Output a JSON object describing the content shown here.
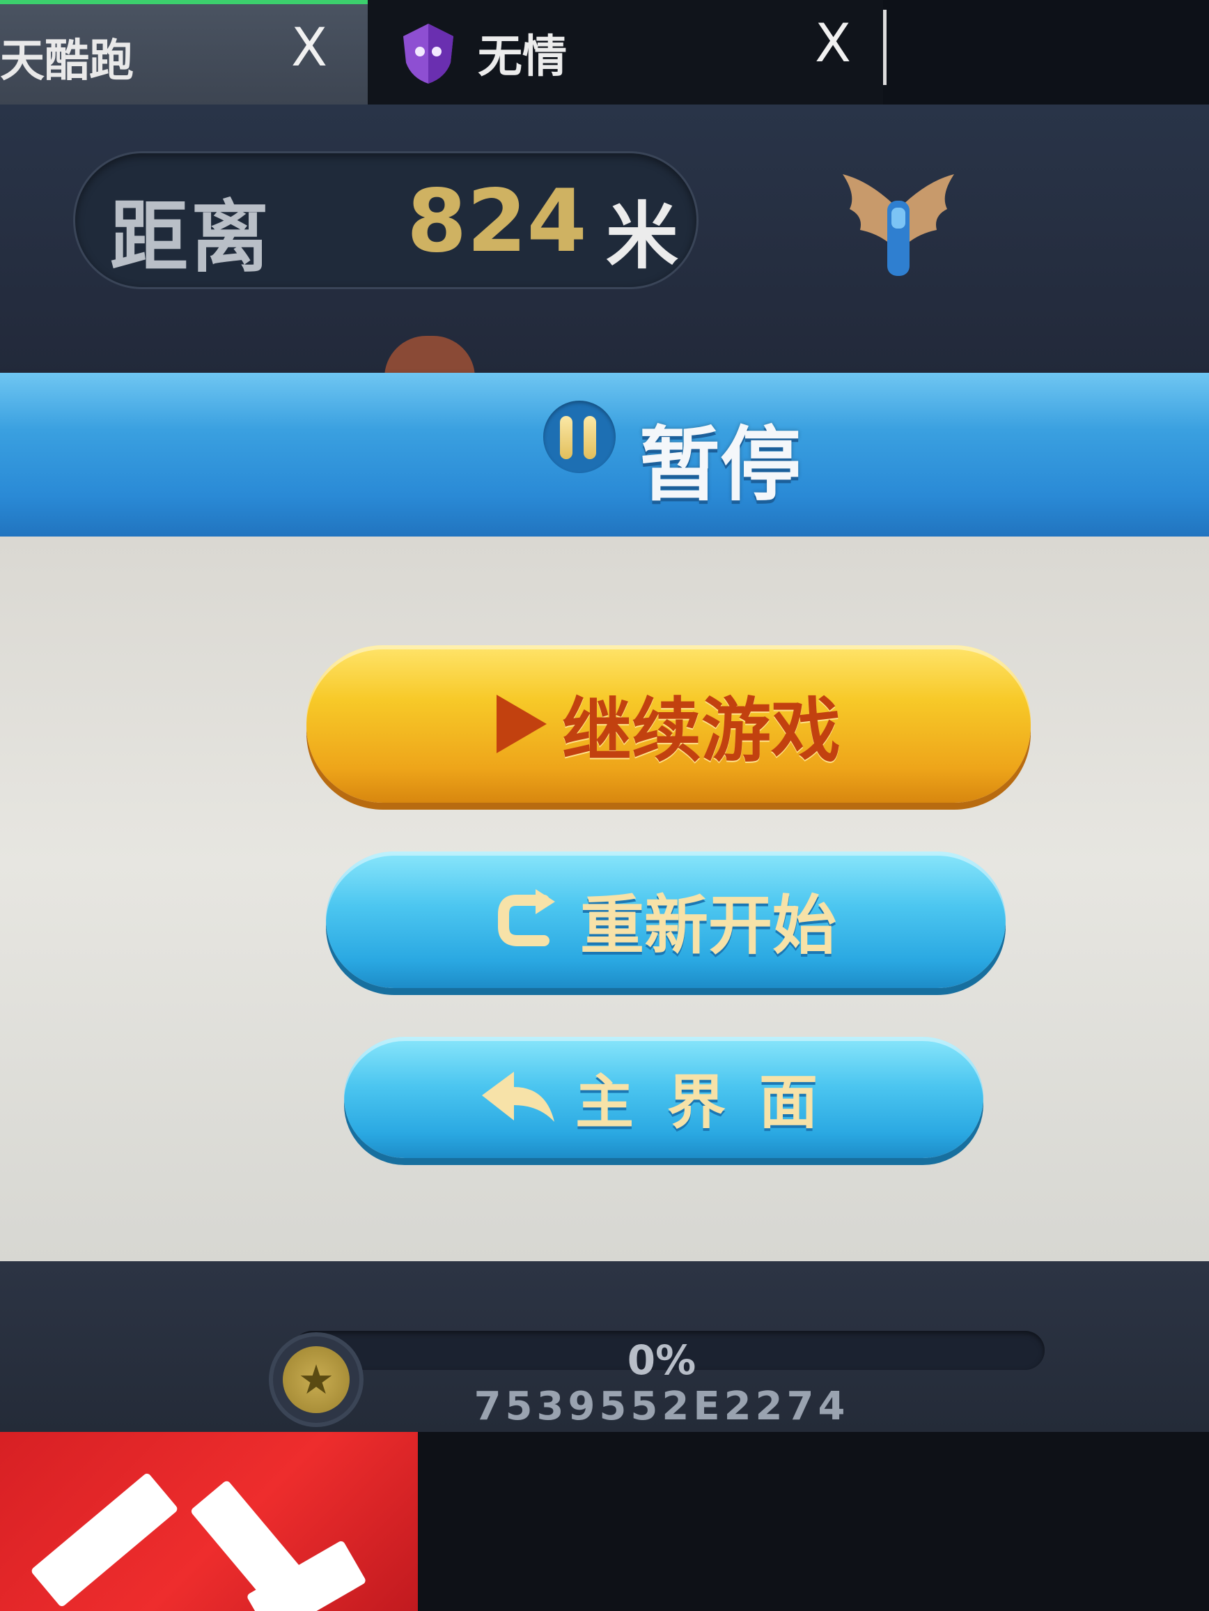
{
  "tabs": [
    {
      "title": "天酷跑",
      "close_label": "X"
    },
    {
      "title": "无情",
      "close_label": "X",
      "icon": "shield-icon"
    }
  ],
  "hud": {
    "distance_label": "距离",
    "distance_value": "824",
    "distance_unit": "米",
    "badge_icon": "winged-badge-icon"
  },
  "pause": {
    "title": "暂停",
    "icon": "pause-icon"
  },
  "menu": {
    "continue_label": "继续游戏",
    "continue_icon": "play-icon",
    "restart_label": "重新开始",
    "restart_icon": "restart-arrow-icon",
    "main_label": "主界面",
    "main_icon": "back-arrow-icon"
  },
  "progress": {
    "percent_text": "0%",
    "fraction": 0.0,
    "code": "7539552E2274",
    "coin_icon": "star-coin-icon"
  },
  "colors": {
    "banner_blue": "#2a8ad6",
    "continue_yellow": "#f7c928",
    "restart_cyan": "#4cc6f0",
    "label_orange": "#c2410f",
    "label_cream": "#f7e2a8",
    "distance_gold": "#cfb262"
  }
}
